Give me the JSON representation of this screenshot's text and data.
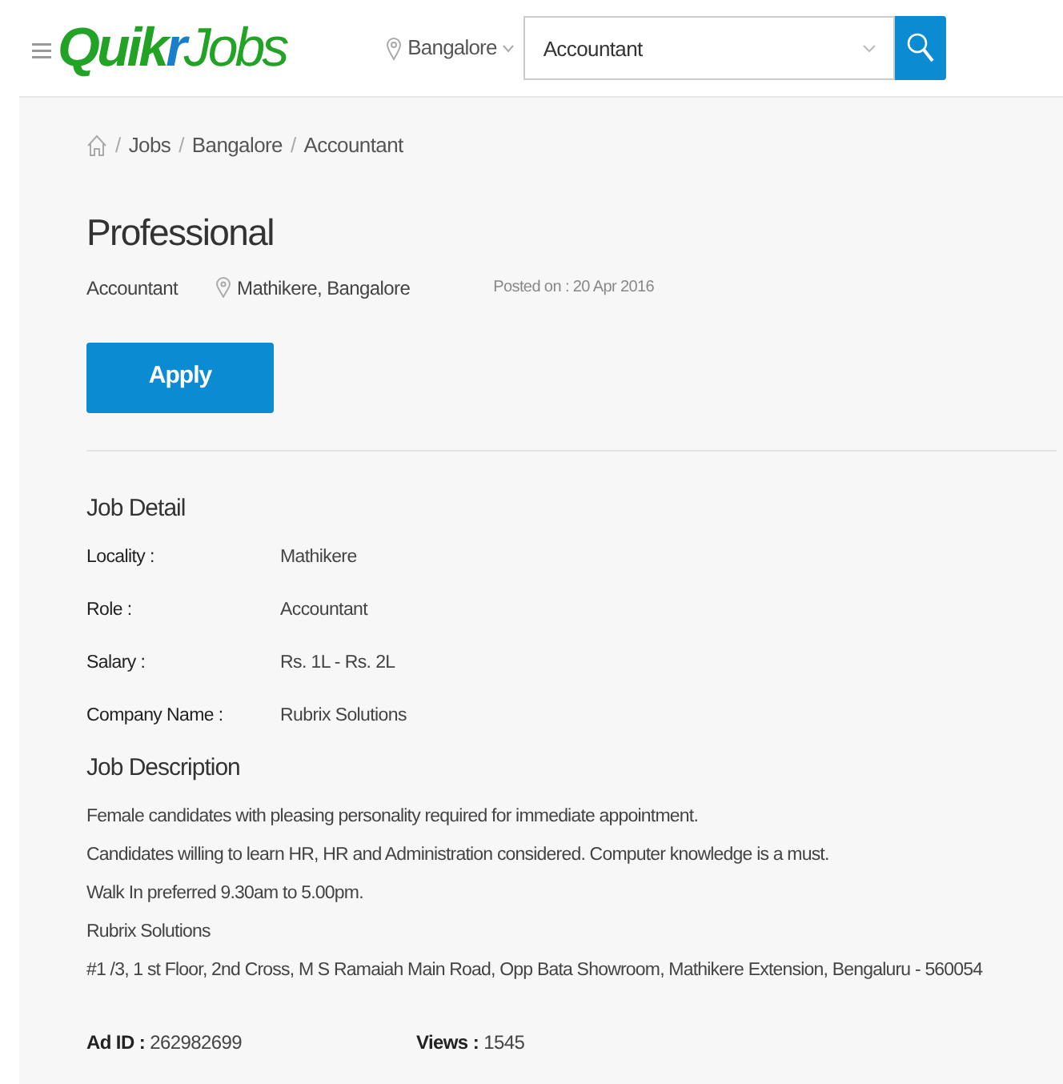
{
  "header": {
    "logo": [
      {
        "text": "Quik",
        "color": "#22a326"
      },
      {
        "text": "r",
        "color": "#1a7fc9"
      },
      {
        "text": "Jobs",
        "color": "#22a326"
      }
    ],
    "city": "Bangalore",
    "search": {
      "value": "Accountant"
    }
  },
  "breadcrumb": [
    {
      "separator": "/",
      "label": "Jobs"
    },
    {
      "separator": "/",
      "label": "Bangalore"
    },
    {
      "separator": "/",
      "label": "Accountant"
    }
  ],
  "job": {
    "title": "Professional",
    "role": "Accountant",
    "location": "Mathikere, Bangalore",
    "posted": "Posted on : 20 Apr 2016",
    "apply": "Apply"
  },
  "job_detail": {
    "heading": "Job Detail",
    "rows": [
      {
        "label": "Locality :",
        "value": "Mathikere"
      },
      {
        "label": "Role :",
        "value": "Accountant"
      },
      {
        "label": "Salary :",
        "value": "Rs. 1L - Rs. 2L"
      },
      {
        "label": "Company Name :",
        "value": "Rubrix Solutions"
      }
    ]
  },
  "job_description": {
    "heading": "Job Description",
    "lines": [
      "Female candidates with pleasing personality required for immediate appointment.",
      "Candidates willing to learn HR, HR and Administration considered. Computer knowledge is a must.",
      "Walk In preferred 9.30am to 5.00pm.",
      "Rubrix Solutions",
      "#1 /3, 1 st Floor, 2nd Cross, M S Ramaiah Main Road, Opp Bata Showroom, Mathikere Extension, Bengaluru - 560054"
    ]
  },
  "meta": [
    {
      "label": "Ad ID :",
      "value": "262982699"
    },
    {
      "label": "Views :",
      "value": "1545"
    }
  ]
}
